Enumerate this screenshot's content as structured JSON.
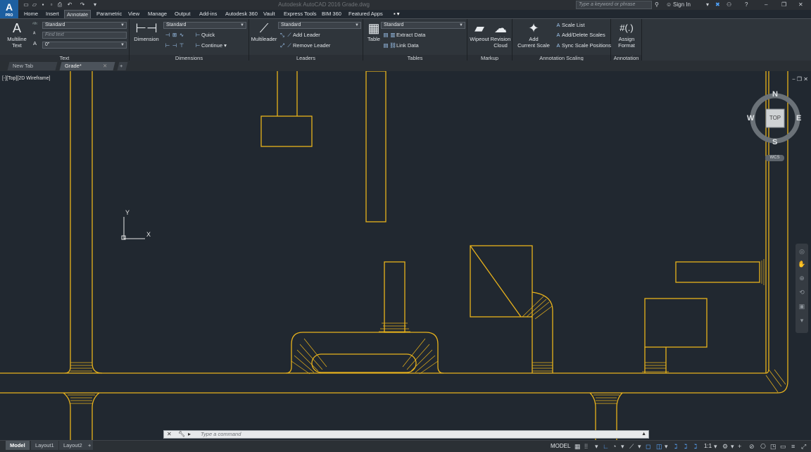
{
  "app": {
    "logo_text": "A",
    "logo_sub": "PRO",
    "window_title": "Autodesk AutoCAD 2016   Grade.dwg",
    "search_placeholder": "Type a keyword or phrase",
    "sign_in": "Sign In"
  },
  "ribbon_tabs": [
    "Home",
    "Insert",
    "Annotate",
    "Parametric",
    "View",
    "Manage",
    "Output",
    "Add-ins",
    "Autodesk 360",
    "Vault",
    "Express Tools",
    "BIM 360",
    "Featured Apps"
  ],
  "active_ribbon_tab": "Annotate",
  "panels": {
    "text": {
      "title": "Text",
      "multiline_label": "Multiline\nText",
      "style_value": "Standard",
      "find_placeholder": "Find text",
      "height_value": "0\""
    },
    "dimensions": {
      "title": "Dimensions",
      "dimension_label": "Dimension",
      "style_value": "Standard",
      "quick_label": "Quick",
      "continue_label": "Continue"
    },
    "leaders": {
      "title": "Leaders",
      "multileader_label": "Multileader",
      "style_value": "Standard",
      "add_leader_label": "Add Leader",
      "remove_leader_label": "Remove Leader"
    },
    "tables": {
      "title": "Tables",
      "table_label": "Table",
      "style_value": "Standard",
      "extract_label": "Extract Data",
      "link_label": "Link Data"
    },
    "markup": {
      "title": "Markup",
      "wipeout_label": "Wipeout",
      "revision_label": "Revision\nCloud"
    },
    "annotation_scaling": {
      "title": "Annotation Scaling",
      "add_scale_label": "Add\nCurrent Scale",
      "scale_list_label": "Scale List",
      "add_delete_label": "Add/Delete Scales",
      "sync_label": "Sync Scale Positions"
    },
    "annotation": {
      "title": "Annotation",
      "assign_label": "Assign\nFormat"
    }
  },
  "file_tabs": [
    "New Tab",
    "Grade*"
  ],
  "active_file_tab": "Grade*",
  "viewport": {
    "label": "[-][Top][2D Wireframe]",
    "compass": {
      "n": "N",
      "s": "S",
      "e": "E",
      "w": "W",
      "face": "TOP"
    },
    "wcs": "WCS",
    "ucs_x": "X",
    "ucs_y": "Y"
  },
  "command_line": {
    "placeholder": "Type a command",
    "prompt_icon": "▸"
  },
  "layout_tabs": [
    "Model",
    "Layout1",
    "Layout2"
  ],
  "active_layout": "Model",
  "status": {
    "model": "MODEL",
    "scale": "1:1"
  },
  "colors": {
    "drawing_bg": "#212830",
    "linework": "#e8b21c",
    "ribbon_bg": "#2f353b"
  }
}
